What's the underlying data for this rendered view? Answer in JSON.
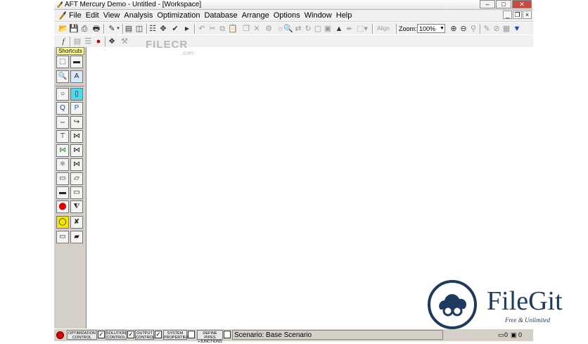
{
  "title": "AFT Mercury Demo - Untitled - [Workspace]",
  "window_buttons": {
    "minimize": "‒",
    "maximize": "□",
    "close": "✕"
  },
  "menu": [
    "File",
    "Edit",
    "View",
    "Analysis",
    "Optimization",
    "Database",
    "Arrange",
    "Options",
    "Window",
    "Help"
  ],
  "toolbar": {
    "align_label": "Align",
    "zoom_label": "Zoom:",
    "zoom_value": "100%"
  },
  "palette": {
    "shortcuts_label": "Shortcuts"
  },
  "status": {
    "buttons": [
      {
        "line1": "OPTIMIZATION",
        "line2": "CONTROL",
        "checked": true
      },
      {
        "line1": "SOLUTION",
        "line2": "CONTROL",
        "checked": true
      },
      {
        "line1": "OUTPUT",
        "line2": "CONTROL",
        "checked": true
      },
      {
        "line1": "SYSTEM",
        "line2": "PROPERTIES",
        "checked": false
      },
      {
        "line1": "DEFINE PIPES",
        "line2": "+JUNCTIONS",
        "checked": false
      }
    ],
    "scenario": "Scenario: Base Scenario",
    "pipe_count": "0",
    "junction_count": "0"
  },
  "watermarks": {
    "filecr": "FILECR",
    "filecr_sub": ".com",
    "filegit": "FileGit",
    "filegit_sub": "Free & Unlimited"
  },
  "colors": {
    "accent_navy": "#1e3a5c",
    "stop_red": "#dd0000",
    "shortcut_yellow": "#ffff99"
  }
}
